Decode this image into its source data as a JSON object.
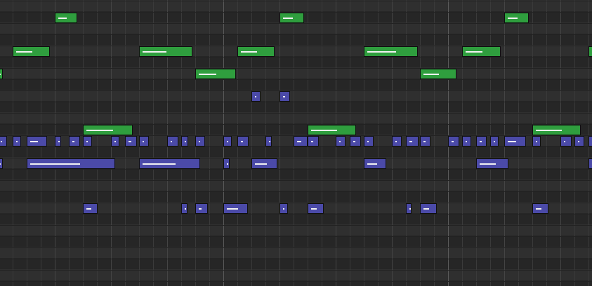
{
  "colors": {
    "green_note": "#2f9e3e",
    "blue_note": "#4b4aa8",
    "row_light": "#2f2f2f",
    "row_dark": "#262626"
  },
  "notes": [
    {
      "track": "green",
      "row": 0,
      "start": 78,
      "len": 32,
      "vel": 0.5
    },
    {
      "track": "green",
      "row": 0,
      "start": 398,
      "len": 35,
      "vel": 0.5
    },
    {
      "track": "green",
      "row": 0,
      "start": 718,
      "len": 35,
      "vel": 0.5
    },
    {
      "track": "green",
      "row": 2,
      "start": 18,
      "len": 53,
      "vel": 0.5
    },
    {
      "track": "green",
      "row": 2,
      "start": 198,
      "len": 76,
      "vel": 0.5
    },
    {
      "track": "green",
      "row": 2,
      "start": 338,
      "len": 53,
      "vel": 0.5
    },
    {
      "track": "green",
      "row": 2,
      "start": 518,
      "len": 77,
      "vel": 0.6
    },
    {
      "track": "green",
      "row": 2,
      "start": 658,
      "len": 55,
      "vel": 0.5
    },
    {
      "track": "green",
      "row": 2,
      "start": 838,
      "len": 10,
      "vel": 0.5
    },
    {
      "track": "green",
      "row": 3,
      "start": -6,
      "len": 10,
      "vel": 0.5
    },
    {
      "track": "green",
      "row": 3,
      "start": 278,
      "len": 58,
      "vel": 0.5
    },
    {
      "track": "green",
      "row": 3,
      "start": 598,
      "len": 52,
      "vel": 0.5
    },
    {
      "track": "blue",
      "row": 4,
      "start": 358,
      "len": 13,
      "vel": 0.4
    },
    {
      "track": "blue",
      "row": 4,
      "start": 398,
      "len": 15,
      "vel": 0.4
    },
    {
      "track": "green",
      "row": 5,
      "start": 118,
      "len": 71,
      "vel": 0.6
    },
    {
      "track": "green",
      "row": 5,
      "start": 438,
      "len": 69,
      "vel": 0.6
    },
    {
      "track": "green",
      "row": 5,
      "start": 758,
      "len": 69,
      "vel": 0.6
    },
    {
      "track": "blue",
      "row": 6,
      "start": -4,
      "len": 14,
      "vel": 0.3
    },
    {
      "track": "blue",
      "row": 6,
      "start": 18,
      "len": 12,
      "vel": 0.2
    },
    {
      "track": "blue",
      "row": 6,
      "start": 38,
      "len": 29,
      "vel": 0.5
    },
    {
      "track": "blue",
      "row": 6,
      "start": 78,
      "len": 9,
      "vel": 0.2
    },
    {
      "track": "blue",
      "row": 6,
      "start": 98,
      "len": 16,
      "vel": 0.4
    },
    {
      "track": "blue",
      "row": 6,
      "start": 118,
      "len": 13,
      "vel": 0.4
    },
    {
      "track": "blue",
      "row": 6,
      "start": 158,
      "len": 12,
      "vel": 0.2
    },
    {
      "track": "blue",
      "row": 6,
      "start": 178,
      "len": 17,
      "vel": 0.4
    },
    {
      "track": "blue",
      "row": 6,
      "start": 198,
      "len": 14,
      "vel": 0.4
    },
    {
      "track": "blue",
      "row": 6,
      "start": 238,
      "len": 16,
      "vel": 0.3
    },
    {
      "track": "blue",
      "row": 6,
      "start": 258,
      "len": 10,
      "vel": 0.2
    },
    {
      "track": "blue",
      "row": 6,
      "start": 278,
      "len": 14,
      "vel": 0.4
    },
    {
      "track": "blue",
      "row": 6,
      "start": 318,
      "len": 12,
      "vel": 0.2
    },
    {
      "track": "blue",
      "row": 6,
      "start": 338,
      "len": 16,
      "vel": 0.4
    },
    {
      "track": "blue",
      "row": 6,
      "start": 378,
      "len": 9,
      "vel": 0.2
    },
    {
      "track": "blue",
      "row": 6,
      "start": 418,
      "len": 20,
      "vel": 0.5
    },
    {
      "track": "blue",
      "row": 6,
      "start": 438,
      "len": 16,
      "vel": 0.4
    },
    {
      "track": "blue",
      "row": 6,
      "start": 478,
      "len": 14,
      "vel": 0.3
    },
    {
      "track": "blue",
      "row": 6,
      "start": 498,
      "len": 16,
      "vel": 0.4
    },
    {
      "track": "blue",
      "row": 6,
      "start": 518,
      "len": 14,
      "vel": 0.4
    },
    {
      "track": "blue",
      "row": 6,
      "start": 558,
      "len": 14,
      "vel": 0.2
    },
    {
      "track": "blue",
      "row": 6,
      "start": 578,
      "len": 18,
      "vel": 0.4
    },
    {
      "track": "blue",
      "row": 6,
      "start": 598,
      "len": 15,
      "vel": 0.4
    },
    {
      "track": "blue",
      "row": 6,
      "start": 638,
      "len": 16,
      "vel": 0.4
    },
    {
      "track": "blue",
      "row": 6,
      "start": 658,
      "len": 13,
      "vel": 0.3
    },
    {
      "track": "blue",
      "row": 6,
      "start": 678,
      "len": 15,
      "vel": 0.4
    },
    {
      "track": "blue",
      "row": 6,
      "start": 698,
      "len": 12,
      "vel": 0.2
    },
    {
      "track": "blue",
      "row": 6,
      "start": 718,
      "len": 31,
      "vel": 0.5
    },
    {
      "track": "blue",
      "row": 6,
      "start": 758,
      "len": 12,
      "vel": 0.3
    },
    {
      "track": "blue",
      "row": 6,
      "start": 798,
      "len": 16,
      "vel": 0.3
    },
    {
      "track": "blue",
      "row": 6,
      "start": 818,
      "len": 14,
      "vel": 0.4
    },
    {
      "track": "blue",
      "row": 6,
      "start": 838,
      "len": 10,
      "vel": 0.3
    },
    {
      "track": "blue",
      "row": 7,
      "start": -6,
      "len": 10,
      "vel": 0.2
    },
    {
      "track": "blue",
      "row": 7,
      "start": 38,
      "len": 126,
      "vel": 0.6
    },
    {
      "track": "blue",
      "row": 7,
      "start": 198,
      "len": 87,
      "vel": 0.6
    },
    {
      "track": "blue",
      "row": 7,
      "start": 318,
      "len": 9,
      "vel": 0.2
    },
    {
      "track": "blue",
      "row": 7,
      "start": 358,
      "len": 37,
      "vel": 0.6
    },
    {
      "track": "blue",
      "row": 7,
      "start": 518,
      "len": 32,
      "vel": 0.6
    },
    {
      "track": "blue",
      "row": 7,
      "start": 678,
      "len": 46,
      "vel": 0.6
    },
    {
      "track": "blue",
      "row": 7,
      "start": 838,
      "len": 10,
      "vel": 0.2
    },
    {
      "track": "blue",
      "row": 9,
      "start": 118,
      "len": 21,
      "vel": 0.5
    },
    {
      "track": "blue",
      "row": 9,
      "start": 258,
      "len": 9,
      "vel": 0.2
    },
    {
      "track": "blue",
      "row": 9,
      "start": 278,
      "len": 18,
      "vel": 0.4
    },
    {
      "track": "blue",
      "row": 9,
      "start": 318,
      "len": 35,
      "vel": 0.6
    },
    {
      "track": "blue",
      "row": 9,
      "start": 398,
      "len": 12,
      "vel": 0.3
    },
    {
      "track": "blue",
      "row": 9,
      "start": 438,
      "len": 23,
      "vel": 0.5
    },
    {
      "track": "blue",
      "row": 9,
      "start": 578,
      "len": 8,
      "vel": 0.2
    },
    {
      "track": "blue",
      "row": 9,
      "start": 598,
      "len": 24,
      "vel": 0.5
    },
    {
      "track": "blue",
      "row": 9,
      "start": 758,
      "len": 23,
      "vel": 0.5
    }
  ]
}
